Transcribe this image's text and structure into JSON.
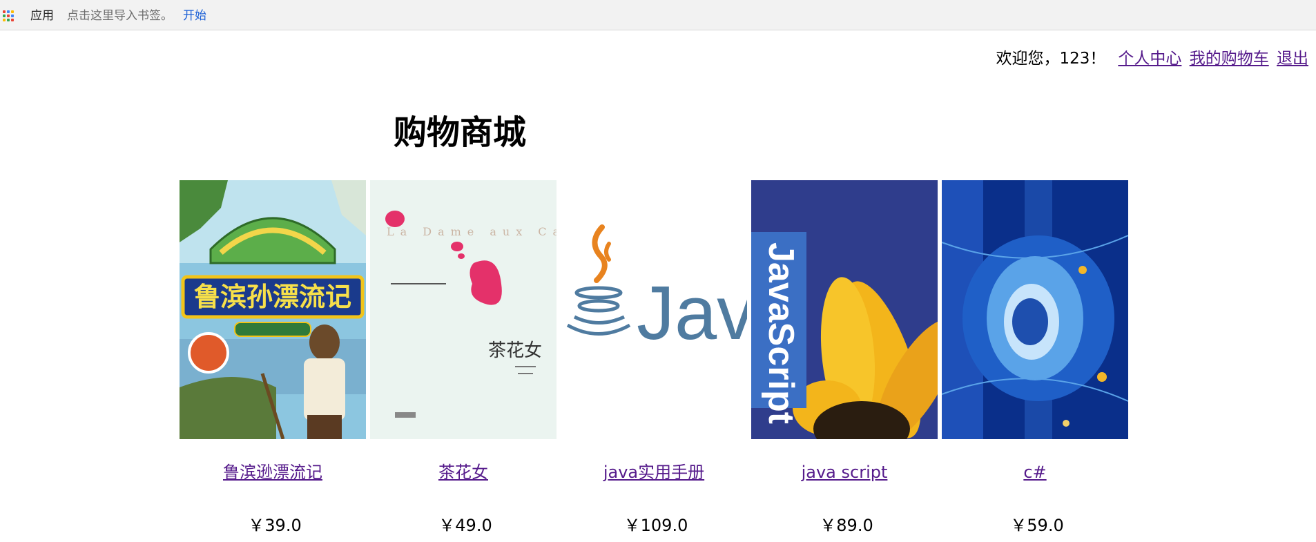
{
  "bookmarks_bar": {
    "apps_label": "应用",
    "import_hint": "点击这里导入书签。",
    "start_link": "开始"
  },
  "user_bar": {
    "welcome_text": "欢迎您，123！",
    "profile_link": "个人中心",
    "cart_link": "我的购物车",
    "logout_link": "退出"
  },
  "page": {
    "title": "购物商城"
  },
  "products": [
    {
      "name": "鲁滨逊漂流记",
      "price": "￥39.0",
      "cover_icon": "robinson-crusoe-book-cover",
      "cover_text": "鲁滨孙漂流记"
    },
    {
      "name": "茶花女",
      "price": "￥49.0",
      "cover_icon": "la-dame-aux-camelias-book-cover",
      "cover_text": "茶花女",
      "cover_subtitle": "La Dame aux Camélias"
    },
    {
      "name": "java实用手册",
      "price": "￥109.0",
      "cover_icon": "java-logo",
      "cover_text": "Java"
    },
    {
      "name": "java script",
      "price": "￥89.0",
      "cover_icon": "javascript-book-cover",
      "cover_text": "JavaScript"
    },
    {
      "name": "c#",
      "price": "￥59.0",
      "cover_icon": "csharp-book-cover"
    }
  ],
  "colors": {
    "link_visited": "#551a8b",
    "bookmark_link": "#1a5fd6",
    "bar_background": "#f2f2f2"
  }
}
